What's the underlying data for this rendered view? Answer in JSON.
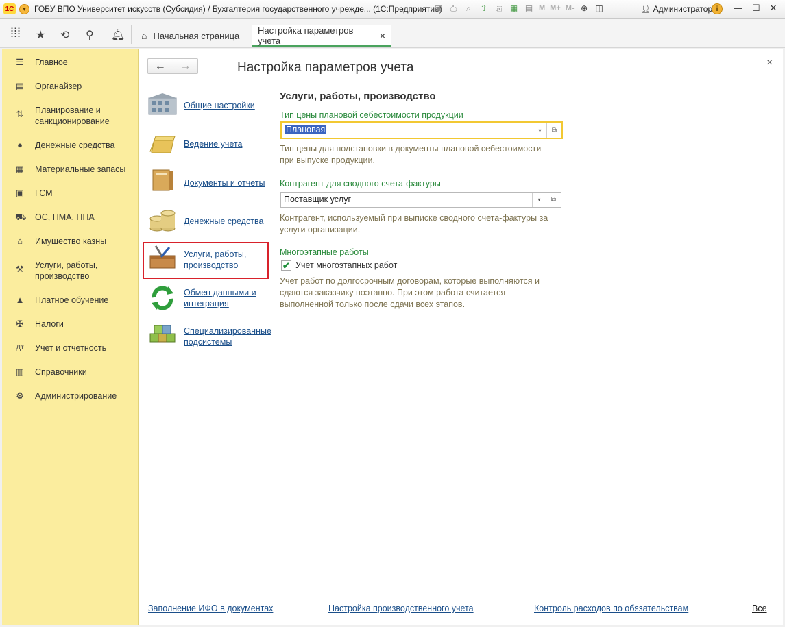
{
  "titlebar": {
    "logo": "1С",
    "title": "ГОБУ ВПО Университет искусств (Субсидия) / Бухгалтерия государственного учрежде... (1С:Предприятие)",
    "m_labels": [
      "M",
      "M+",
      "M-"
    ],
    "user": "Администратор",
    "help": "i"
  },
  "topbar": {
    "tabs": [
      {
        "label": "Начальная страница",
        "icon": "home-icon"
      },
      {
        "label": "Настройка параметров учета",
        "close": "×"
      }
    ]
  },
  "sidebar": {
    "items": [
      {
        "label": "Главное",
        "icon": "menu-lines-icon"
      },
      {
        "label": "Органайзер",
        "icon": "organizer-icon"
      },
      {
        "label": "Планирование и санкционирование",
        "icon": "planning-icon"
      },
      {
        "label": "Денежные средства",
        "icon": "ruble-icon"
      },
      {
        "label": "Материальные запасы",
        "icon": "grid-icon"
      },
      {
        "label": "ГСМ",
        "icon": "fuel-icon"
      },
      {
        "label": "ОС, НМА, НПА",
        "icon": "truck-icon"
      },
      {
        "label": "Имущество казны",
        "icon": "bank-icon"
      },
      {
        "label": "Услуги, работы, производство",
        "icon": "tools-icon"
      },
      {
        "label": "Платное обучение",
        "icon": "graduation-icon"
      },
      {
        "label": "Налоги",
        "icon": "emblem-icon"
      },
      {
        "label": "Учет и отчетность",
        "icon": "debit-credit-icon"
      },
      {
        "label": "Справочники",
        "icon": "books-icon"
      },
      {
        "label": "Администрирование",
        "icon": "gear-icon"
      }
    ]
  },
  "form": {
    "title": "Настройка параметров учета",
    "close": "×",
    "sections": [
      {
        "label": "Общие настройки",
        "icon": "building-icon"
      },
      {
        "label": "Ведение учета",
        "icon": "folder-icon"
      },
      {
        "label": "Документы и отчеты",
        "icon": "binder-icon"
      },
      {
        "label": "Денежные средства",
        "icon": "coins-icon"
      },
      {
        "label": "Услуги, работы, производство",
        "icon": "toolbox-icon"
      },
      {
        "label": "Обмен данными и интеграция",
        "icon": "sync-icon"
      },
      {
        "label": "Специализированные подсистемы",
        "icon": "cubes-icon"
      }
    ],
    "group_title": "Услуги, работы, производство",
    "field1": {
      "label": "Тип цены плановой себестоимости продукции",
      "value": "Плановая",
      "hint": "Тип цены для подстановки в документы плановой себестоимости при выпуске продукции."
    },
    "field2": {
      "label": "Контрагент для сводного счета-фактуры",
      "value": "Поставщик услуг",
      "hint": "Контрагент, используемый при выписке сводного счета-фактуры за услуги организации."
    },
    "multistage": {
      "label": "Многоэтапные работы",
      "checkbox_label": "Учет многоэтапных работ",
      "checked": true,
      "hint": "Учет работ по долгосрочным договорам, которые выполняются и сдаются заказчику поэтапно. При этом работа считается выполненной только после сдачи всех этапов."
    },
    "footer_links": [
      "Заполнение ИФО в документах",
      "Настройка производственного учета",
      "Контроль расходов по обязательствам"
    ],
    "footer_all": "Все"
  },
  "colors": {
    "sidebar_bg": "#fbed9e",
    "accent_green": "#2a8a3c",
    "link_blue": "#1b4f8a",
    "highlight_red": "#d8222b",
    "focus_yellow": "#f2c832"
  }
}
